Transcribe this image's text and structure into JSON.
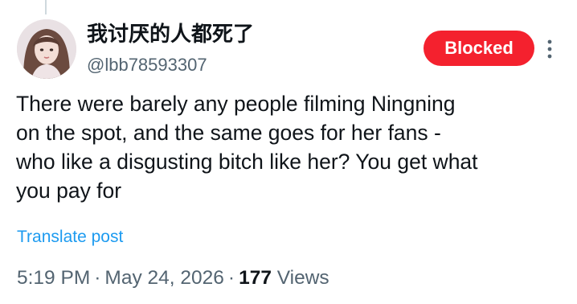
{
  "author": {
    "display_name": "我讨厌的人都死了",
    "handle": "@lbb78593307"
  },
  "actions": {
    "blocked_label": "Blocked",
    "more_icon": "more-vertical-icon"
  },
  "post": {
    "text": "There were barely any people filming Ningning\non the spot, and the same goes for her fans -\nwho like a disgusting bitch like her? You get what\nyou pay for",
    "translate_label": "Translate post"
  },
  "meta": {
    "time": "5:19 PM",
    "separator": "·",
    "date": "May 24, 2026",
    "views_count": "177",
    "views_label": "Views"
  },
  "colors": {
    "blocked_bg": "#f4212e",
    "link": "#1d9bf0",
    "secondary_text": "#536471"
  }
}
